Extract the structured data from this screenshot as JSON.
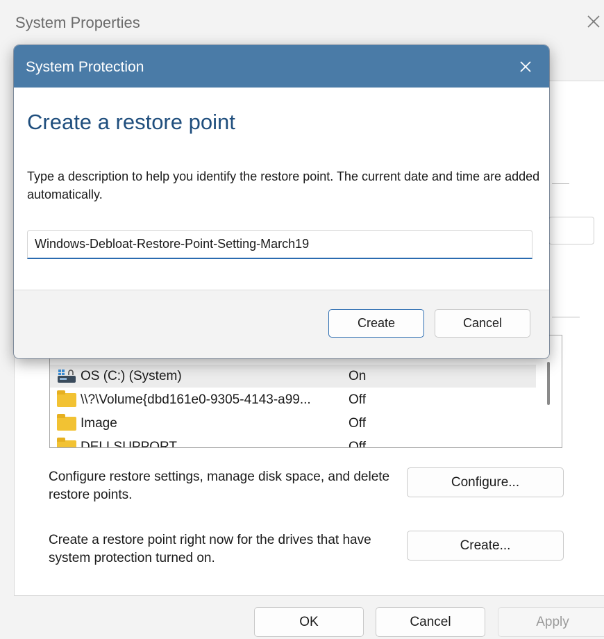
{
  "system_properties": {
    "title": "System Properties",
    "close_icon": "close-icon",
    "drives": [
      {
        "name": "OS (C:) (System)",
        "status": "On",
        "icon": "system-drive-icon",
        "selected": true
      },
      {
        "name": "\\\\?\\Volume{dbd161e0-9305-4143-a99...",
        "status": "Off",
        "icon": "folder-icon",
        "selected": false
      },
      {
        "name": "Image",
        "status": "Off",
        "icon": "folder-icon",
        "selected": false
      },
      {
        "name": "DELLSUPPORT",
        "status": "Off",
        "icon": "folder-icon",
        "selected": false
      }
    ],
    "configure": {
      "text": "Configure restore settings, manage disk space, and delete restore points.",
      "button": "Configure..."
    },
    "create": {
      "text": "Create a restore point right now for the drives that have system protection turned on.",
      "button": "Create..."
    },
    "buttons": {
      "ok": "OK",
      "cancel": "Cancel",
      "apply": "Apply"
    }
  },
  "dialog": {
    "title": "System Protection",
    "close_icon": "close-icon",
    "heading": "Create a restore point",
    "description": "Type a description to help you identify the restore point. The current date and time are added automatically.",
    "input_value": "Windows-Debloat-Restore-Point-Setting-March19",
    "create_button": "Create",
    "cancel_button": "Cancel",
    "accent_color": "#4a7ba7"
  }
}
